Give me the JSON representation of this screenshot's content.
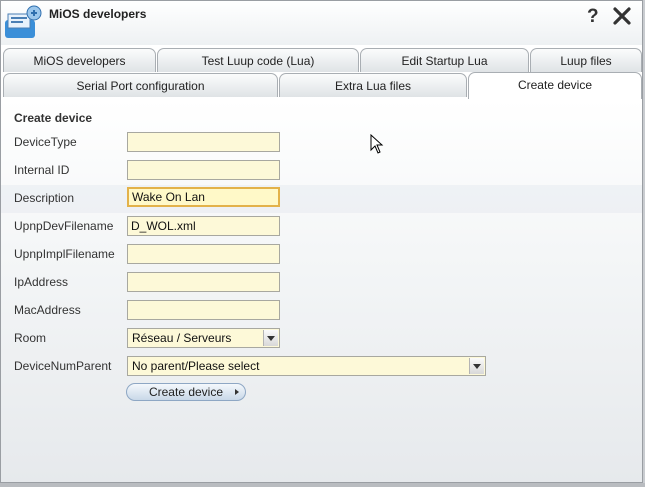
{
  "window": {
    "title": "MiOS developers",
    "help_label": "?"
  },
  "tabs_row1": [
    "MiOS developers",
    "Test Luup code (Lua)",
    "Edit Startup Lua",
    "Luup files"
  ],
  "tabs_row2": [
    "Serial Port configuration",
    "Extra Lua files",
    "Create device"
  ],
  "form": {
    "title": "Create device",
    "fields": [
      {
        "label": "DeviceType",
        "value": ""
      },
      {
        "label": "Internal ID",
        "value": ""
      },
      {
        "label": "Description",
        "value": "Wake On Lan"
      },
      {
        "label": "UpnpDevFilename",
        "value": "D_WOL.xml"
      },
      {
        "label": "UpnpImplFilename",
        "value": ""
      },
      {
        "label": "IpAddress",
        "value": ""
      },
      {
        "label": "MacAddress",
        "value": ""
      }
    ],
    "room_label": "Room",
    "room_value": "Réseau / Serveurs",
    "parent_label": "DeviceNumParent",
    "parent_value": "No parent/Please select",
    "create_button": "Create device"
  },
  "colors": {
    "field_bg": "#fdf9d8",
    "focus_border": "#e3b24a",
    "button_bg": "#c9d8e8"
  }
}
